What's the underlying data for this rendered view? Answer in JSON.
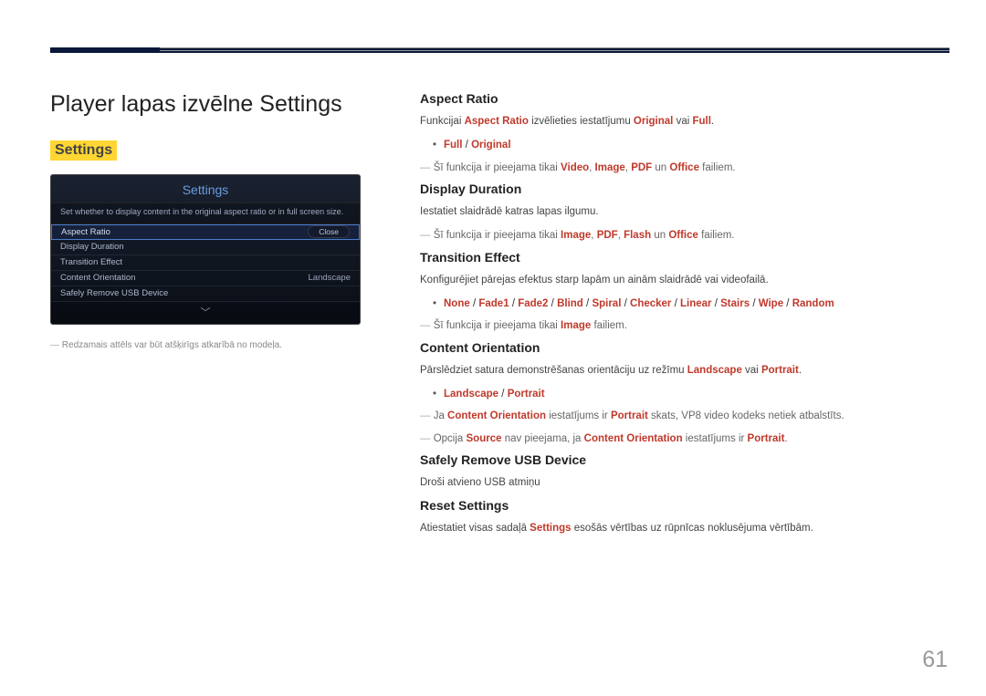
{
  "page": {
    "title": "Player lapas izvēlne Settings",
    "highlight": "Settings",
    "number": "61"
  },
  "osd": {
    "title": "Settings",
    "desc": "Set whether to display content in the original aspect ratio or in full screen size.",
    "rows": [
      {
        "label": "Aspect Ratio",
        "value": ""
      },
      {
        "label": "Display Duration",
        "value": ""
      },
      {
        "label": "Transition Effect",
        "value": ""
      },
      {
        "label": "Content Orientation",
        "value": "Landscape"
      },
      {
        "label": "Safely Remove USB Device",
        "value": ""
      }
    ],
    "close": "Close"
  },
  "leftFootnote": "Redzamais attēls var būt atšķirīgs atkarībā no modeļa.",
  "sections": {
    "aspect": {
      "heading": "Aspect Ratio",
      "p1_a": "Funkcijai ",
      "p1_b": "Aspect Ratio",
      "p1_c": " izvēlieties iestatījumu ",
      "p1_d": "Original",
      "p1_e": " vai ",
      "p1_f": "Full",
      "p1_g": ".",
      "opts": [
        "Full",
        "Original"
      ],
      "note_a": "Šī funkcija ir pieejama tikai ",
      "note_types": [
        "Video",
        "Image",
        "PDF",
        "Office"
      ],
      "note_b": " failiem."
    },
    "duration": {
      "heading": "Display Duration",
      "p1": "Iestatiet slaidrādē katras lapas ilgumu.",
      "note_a": "Šī funkcija ir pieejama tikai ",
      "note_types": [
        "Image",
        "PDF",
        "Flash",
        "Office"
      ],
      "note_b": " failiem."
    },
    "transition": {
      "heading": "Transition Effect",
      "p1": "Konfigurējiet pārejas efektus starp lapām un ainām slaidrādē vai videofailā.",
      "opts": [
        "None",
        "Fade1",
        "Fade2",
        "Blind",
        "Spiral",
        "Checker",
        "Linear",
        "Stairs",
        "Wipe",
        "Random"
      ],
      "note_a": "Šī funkcija ir pieejama tikai ",
      "note_types": [
        "Image"
      ],
      "note_b": " failiem."
    },
    "orient": {
      "heading": "Content Orientation",
      "p1_a": "Pārslēdziet satura demonstrēšanas orientāciju uz režīmu ",
      "p1_b": "Landscape",
      "p1_c": " vai ",
      "p1_d": "Portrait",
      "p1_e": ".",
      "opts": [
        "Landscape",
        "Portrait"
      ],
      "note1_a": "Ja ",
      "note1_b": "Content Orientation",
      "note1_c": " iestatījums ir ",
      "note1_d": "Portrait",
      "note1_e": " skats, VP8 video kodeks netiek atbalstīts.",
      "note2_a": "Opcija ",
      "note2_b": "Source",
      "note2_c": " nav pieejama, ja ",
      "note2_d": "Content Orientation",
      "note2_e": " iestatījums ir ",
      "note2_f": "Portrait",
      "note2_g": "."
    },
    "usb": {
      "heading": "Safely Remove USB Device",
      "p1": "Droši atvieno USB atmiņu"
    },
    "reset": {
      "heading": "Reset Settings",
      "p1_a": "Atiestatiet visas sadaļā ",
      "p1_b": "Settings",
      "p1_c": " esošās vērtības uz rūpnīcas noklusējuma vērtībām."
    }
  }
}
